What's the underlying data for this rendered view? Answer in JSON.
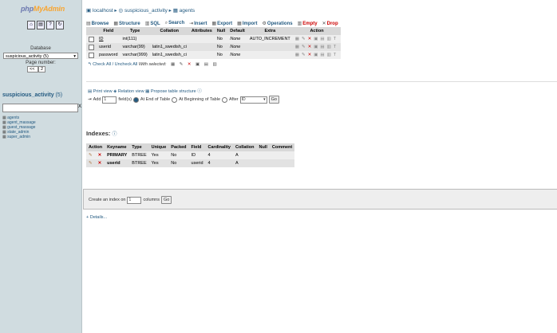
{
  "sidebar": {
    "logo_main": "php",
    "logo_accent": "MyAdmin",
    "database_label": "Database",
    "database_select": "suspicious_activity (5)",
    "page_number_label": "Page number:",
    "page_nav": "<< ",
    "page_value": "2",
    "db_title": "suspicious_activity",
    "db_count": "(5)",
    "tables": [
      "agents",
      "agent_massage",
      "guest_massage",
      "state_admin",
      "super_admin"
    ]
  },
  "breadcrumb": {
    "server": "localhost",
    "database": "suspicious_activity",
    "table": "agents"
  },
  "tabs": [
    {
      "label": "Browse"
    },
    {
      "label": "Structure"
    },
    {
      "label": "SQL"
    },
    {
      "label": "Search"
    },
    {
      "label": "Insert"
    },
    {
      "label": "Export"
    },
    {
      "label": "Import"
    },
    {
      "label": "Operations"
    },
    {
      "label": "Empty"
    },
    {
      "label": "Drop"
    }
  ],
  "structure": {
    "headers": [
      "Field",
      "Type",
      "Collation",
      "Attributes",
      "Null",
      "Default",
      "Extra",
      "Action"
    ],
    "rows": [
      {
        "field": "ID",
        "type": "int(111)",
        "collation": "",
        "attributes": "",
        "null": "No",
        "default": "None",
        "extra": "AUTO_INCREMENT"
      },
      {
        "field": "userid",
        "type": "varchar(99)",
        "collation": "latin1_swedish_ci",
        "attributes": "",
        "null": "No",
        "default": "None",
        "extra": ""
      },
      {
        "field": "password",
        "type": "varchar(999)",
        "collation": "latin1_swedish_ci",
        "attributes": "",
        "null": "No",
        "default": "None",
        "extra": ""
      }
    ],
    "check_all": "Check All / Uncheck All",
    "with_selected": "With selected:"
  },
  "links": {
    "print_view": "Print view",
    "relation_view": "Relation view",
    "propose": "Propose table structure"
  },
  "add_field": {
    "add": "Add",
    "count": "1",
    "fields_label": "field(s)",
    "end_label": "At End of Table",
    "begin_label": "At Beginning of Table",
    "after_label": "After",
    "after_value": "ID",
    "go": "Go"
  },
  "indexes": {
    "title": "Indexes:",
    "headers": [
      "Action",
      "Keyname",
      "Type",
      "Unique",
      "Packed",
      "Field",
      "Cardinality",
      "Collation",
      "Null",
      "Comment"
    ],
    "rows": [
      {
        "keyname": "PRIMARY",
        "type": "BTREE",
        "unique": "Yes",
        "packed": "No",
        "field": "ID",
        "cardinality": "4",
        "collation": "A",
        "null": "",
        "comment": ""
      },
      {
        "keyname": "userid",
        "type": "BTREE",
        "unique": "Yes",
        "packed": "No",
        "field": "userid",
        "cardinality": "4",
        "collation": "A",
        "null": "",
        "comment": ""
      }
    ]
  },
  "create_index": {
    "prefix": "Create an index on",
    "count": "1",
    "suffix": "columns",
    "go": "Go"
  },
  "details": "+ Details..."
}
